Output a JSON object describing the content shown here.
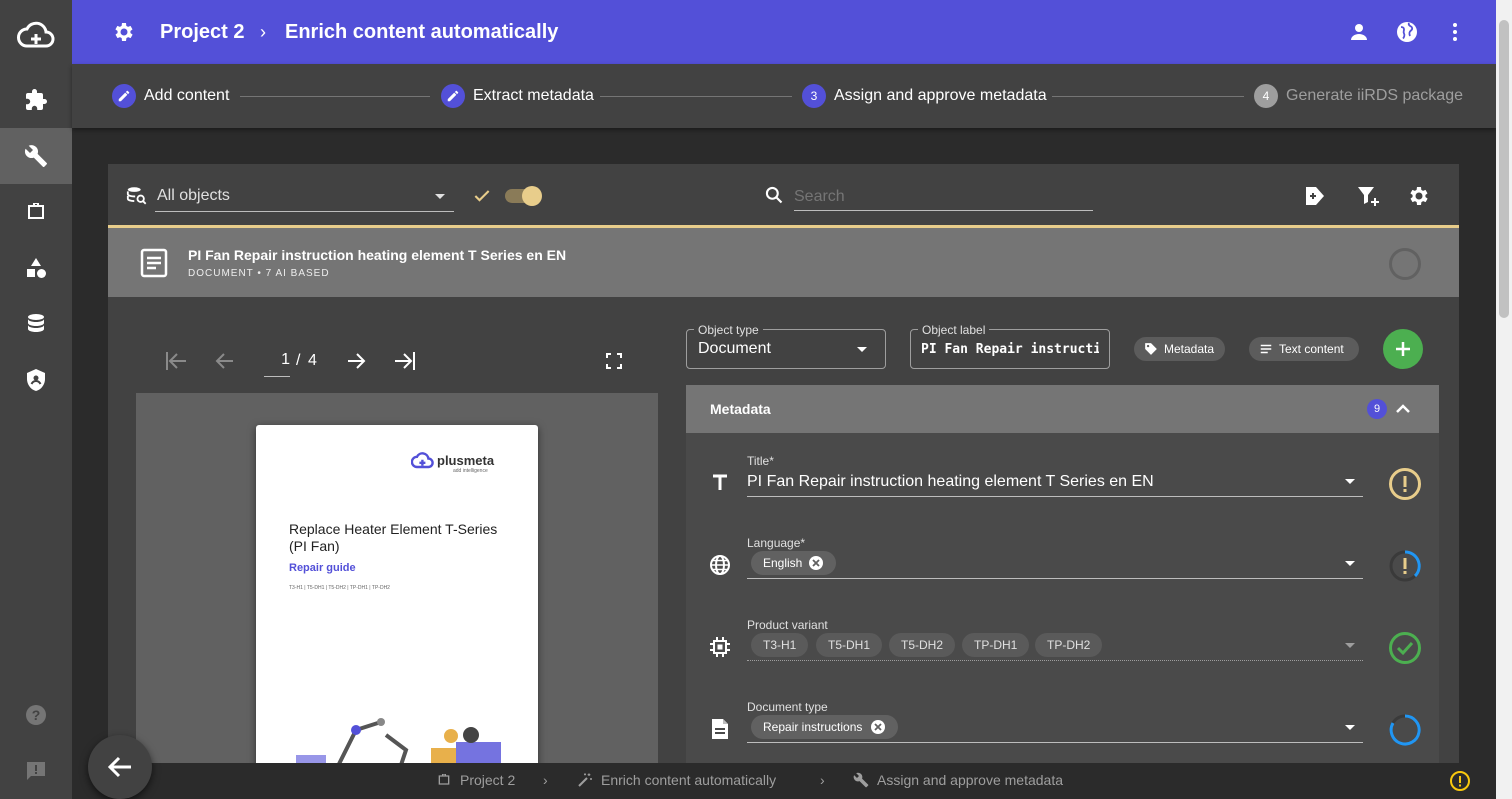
{
  "header": {
    "project": "Project 2",
    "separator": "›",
    "page_title": "Enrich content automatically"
  },
  "stepper": {
    "steps": [
      {
        "label": "Add content",
        "state": "done"
      },
      {
        "label": "Extract metadata",
        "state": "done"
      },
      {
        "label": "Assign and approve metadata",
        "number": "3",
        "state": "active"
      },
      {
        "label": "Generate iiRDS package",
        "number": "4",
        "state": "disabled"
      }
    ]
  },
  "toolbar": {
    "filter_value": "All objects",
    "search_placeholder": "Search"
  },
  "object": {
    "title": "PI Fan Repair instruction heating element T Series en EN",
    "subtitle": "DOCUMENT • 7 AI BASED"
  },
  "viewer": {
    "page_current": "1",
    "page_separator": "/",
    "page_total": "4",
    "doc": {
      "brand": "plusmeta",
      "tagline": "add intelligence",
      "heading": "Replace Heater Element T-Series (PI Fan)",
      "subheading": "Repair guide",
      "variants_line": "T3-H1 | T5-DH1 | T5-DH2 | TP-DH1 | TP-DH2"
    }
  },
  "form": {
    "object_type_label": "Object type",
    "object_type_value": "Document",
    "object_label_label": "Object label",
    "object_label_value": "PI Fan Repair instruction heating element T Series en EN",
    "metadata_chip": "Metadata",
    "text_content_chip": "Text content"
  },
  "metadata": {
    "heading": "Metadata",
    "count": "9",
    "fields": [
      {
        "label": "Title*",
        "value": "PI Fan Repair instruction heating element T Series en EN",
        "status": "warning"
      },
      {
        "label": "Language*",
        "chips": [
          "English"
        ],
        "status": "warning-progress"
      },
      {
        "label": "Product variant",
        "chips": [
          "T3-H1",
          "T5-DH1",
          "T5-DH2",
          "TP-DH1",
          "TP-DH2"
        ],
        "status": "approved"
      },
      {
        "label": "Document type",
        "chips": [
          "Repair instructions"
        ],
        "status": "progress"
      }
    ]
  },
  "bottom_breadcrumb": {
    "items": [
      "Project 2",
      "Enrich content automatically",
      "Assign and approve metadata"
    ],
    "separator": "›"
  },
  "colors": {
    "primary": "#5350d8",
    "accent": "#e8cd8b",
    "success": "#4caf50",
    "info": "#2196f3"
  }
}
